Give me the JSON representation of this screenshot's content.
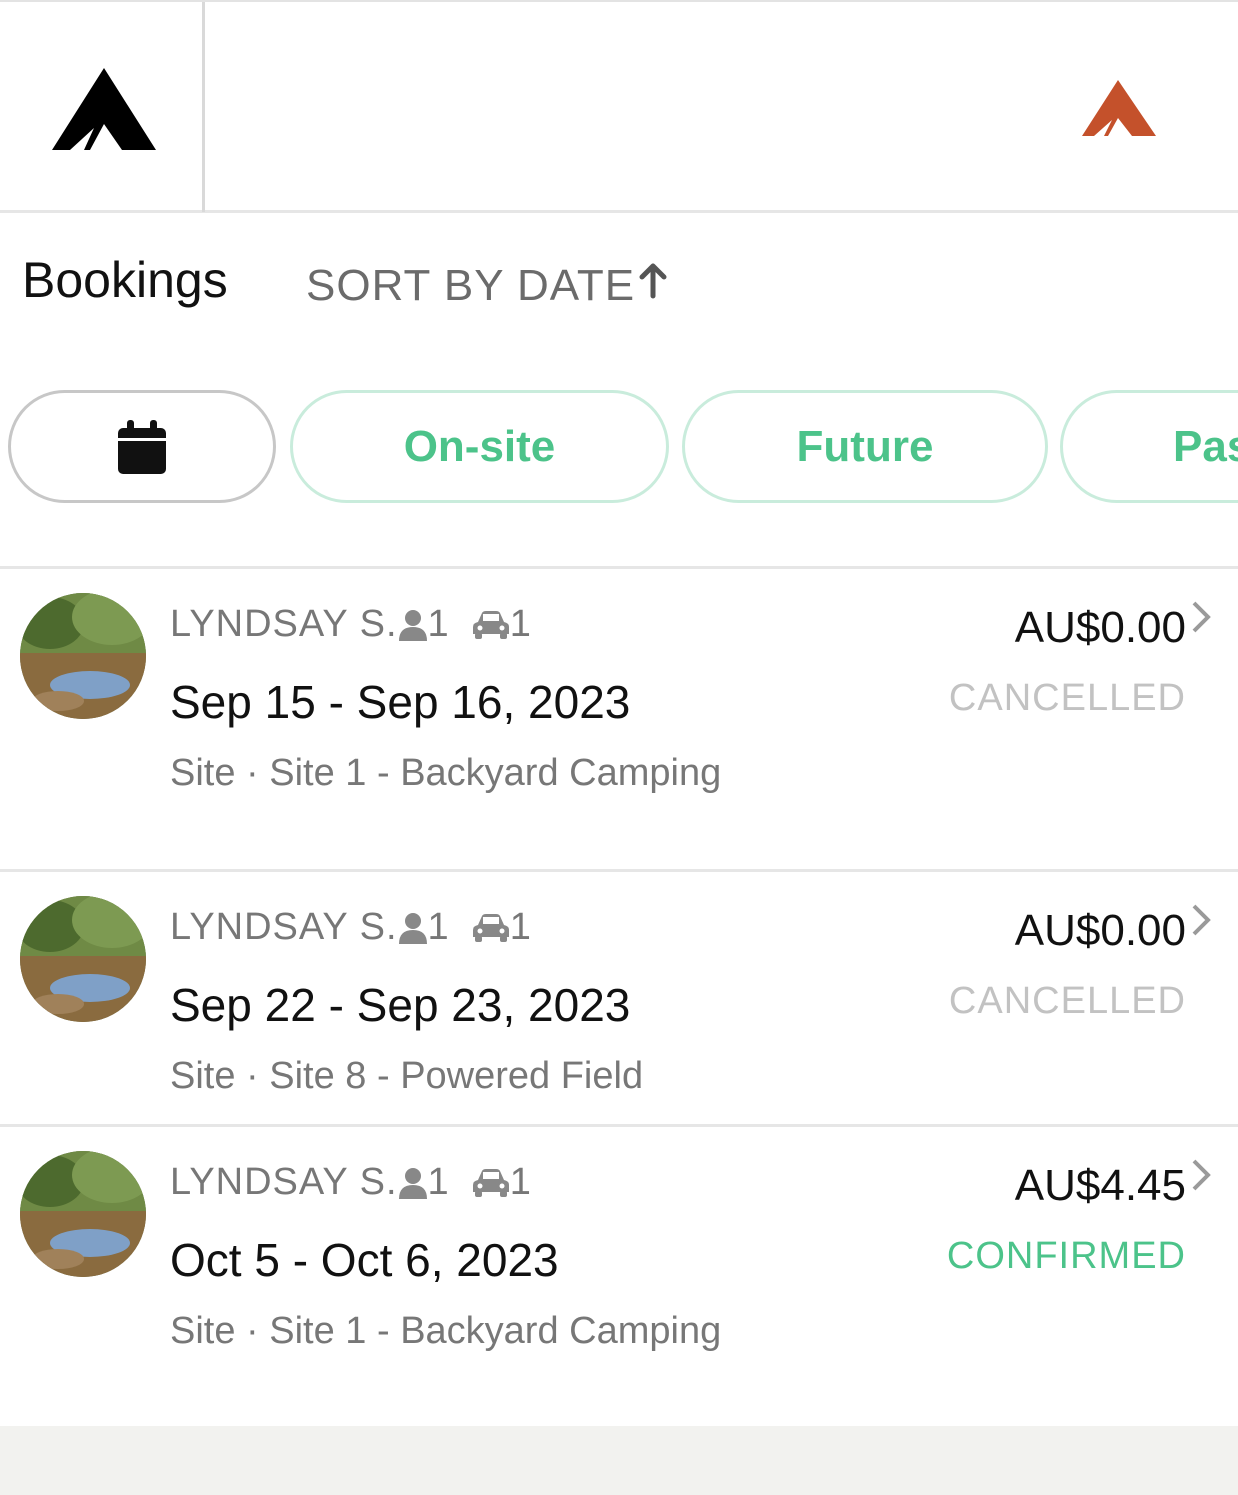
{
  "header": {
    "logo_icon": "tent-logo-icon",
    "accent_logo_icon": "tent-logo-icon",
    "accent_color": "#c4512b"
  },
  "page": {
    "title": "Bookings",
    "sort_label": "SORT BY DATE",
    "sort_icon": "arrow-up-icon"
  },
  "filters": {
    "calendar_icon": "calendar-icon",
    "items": [
      "On-site",
      "Future",
      "Pas"
    ],
    "active_color": "#4cc38a"
  },
  "bookings": [
    {
      "guest": "LYNDSAY S.",
      "guests_count": "1",
      "vehicles_count": "1",
      "dates": "Sep 15 - Sep 16, 2023",
      "site": "Site · Site 1 - Backyard Camping",
      "price": "AU$0.00",
      "status": "CANCELLED",
      "status_color": "#c2c2c2"
    },
    {
      "guest": "LYNDSAY S.",
      "guests_count": "1",
      "vehicles_count": "1",
      "dates": "Sep 22 - Sep 23, 2023",
      "site": "Site · Site 8 - Powered Field",
      "price": "AU$0.00",
      "status": "CANCELLED",
      "status_color": "#c2c2c2"
    },
    {
      "guest": "LYNDSAY S.",
      "guests_count": "1",
      "vehicles_count": "1",
      "dates": "Oct 5 - Oct 6, 2023",
      "site": "Site · Site 1 - Backyard Camping",
      "price": "AU$4.45",
      "status": "CONFIRMED",
      "status_color": "#4cc38a"
    }
  ]
}
